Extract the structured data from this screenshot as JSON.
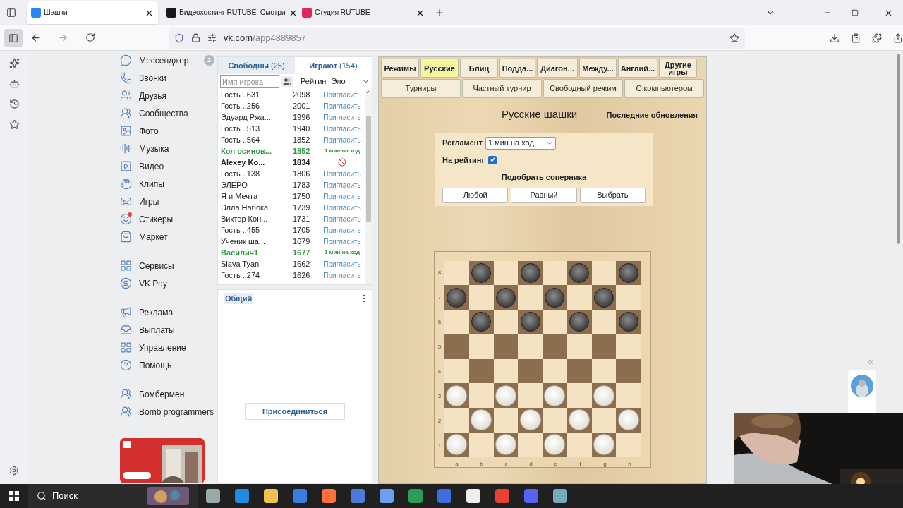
{
  "browser": {
    "tabs": [
      {
        "title": "Шашки",
        "selected": true,
        "color": "#2787f5"
      },
      {
        "title": "Видеохостинг RUTUBE. Смотри",
        "selected": false,
        "color": "#14191f"
      },
      {
        "title": "Студия RUTUBE",
        "selected": false,
        "color": "#e0245e"
      }
    ],
    "url_host": "vk.com",
    "url_path": "/app4889857"
  },
  "nav_groups": [
    [
      {
        "label": "Мессенджер",
        "badge": "2",
        "dot": false
      },
      {
        "label": "Звонки",
        "dot": false
      },
      {
        "label": "Друзья",
        "dot": false
      },
      {
        "label": "Сообщества",
        "dot": false
      },
      {
        "label": "Фото",
        "dot": false
      },
      {
        "label": "Музыка",
        "dot": false
      },
      {
        "label": "Видео",
        "dot": false
      },
      {
        "label": "Клипы",
        "dot": false
      },
      {
        "label": "Игры",
        "dot": false
      },
      {
        "label": "Стикеры",
        "dot": true
      },
      {
        "label": "Маркет",
        "dot": false
      }
    ],
    [
      {
        "label": "Сервисы",
        "dot": false
      },
      {
        "label": "VK Pay",
        "dot": false
      }
    ],
    [
      {
        "label": "Реклама",
        "dot": false
      },
      {
        "label": "Выплаты",
        "dot": false
      },
      {
        "label": "Управление",
        "dot": false
      },
      {
        "label": "Помощь",
        "dot": false
      }
    ],
    [
      {
        "label": "Бомбермен",
        "dot": false
      },
      {
        "label": "Bomb programmers",
        "dot": false
      }
    ]
  ],
  "players": {
    "tabs": [
      {
        "label": "Свободны",
        "count": "(25)",
        "selected": true
      },
      {
        "label": "Играют",
        "count": "(154)",
        "selected": false
      }
    ],
    "search_placeholder": "Имя игрока",
    "sort": "Рейтинг Эло",
    "rows": [
      {
        "name": "Гость ..631",
        "rating": "2098",
        "kind": "invite",
        "action": "Пригласить"
      },
      {
        "name": "Гость ..256",
        "rating": "2001",
        "kind": "invite",
        "action": "Пригласить"
      },
      {
        "name": "Эдуард Ржа...",
        "rating": "1996",
        "kind": "invite",
        "action": "Пригласить"
      },
      {
        "name": "Гость ..513",
        "rating": "1940",
        "kind": "invite",
        "action": "Пригласить"
      },
      {
        "name": "Гость ..564",
        "rating": "1852",
        "kind": "invite",
        "action": "Пригласить"
      },
      {
        "name": "Кол осинов...",
        "rating": "1852",
        "kind": "seeking",
        "action": "1 мин на ход"
      },
      {
        "name": "Alexey Ko...",
        "rating": "1834",
        "kind": "self"
      },
      {
        "name": "Гость ..138",
        "rating": "1806",
        "kind": "invite",
        "action": "Пригласить"
      },
      {
        "name": "ЭЛЕРО",
        "rating": "1783",
        "kind": "invite",
        "action": "Пригласить"
      },
      {
        "name": "Я и Мечта",
        "rating": "1750",
        "kind": "invite",
        "action": "Пригласить"
      },
      {
        "name": "Элла Набока",
        "rating": "1739",
        "kind": "invite",
        "action": "Пригласить"
      },
      {
        "name": "Виктор Кон...",
        "rating": "1731",
        "kind": "invite",
        "action": "Пригласить"
      },
      {
        "name": "Гость ..455",
        "rating": "1705",
        "kind": "invite",
        "action": "Пригласить"
      },
      {
        "name": "Ученик ша...",
        "rating": "1679",
        "kind": "invite",
        "action": "Пригласить"
      },
      {
        "name": "Василич1",
        "rating": "1677",
        "kind": "seeking",
        "action": "1 мин на ход"
      },
      {
        "name": "Slava Tyan",
        "rating": "1662",
        "kind": "invite",
        "action": "Пригласить"
      },
      {
        "name": "Гость ..274",
        "rating": "1626",
        "kind": "invite",
        "action": "Пригласить"
      }
    ]
  },
  "chat": {
    "tab": "Общий",
    "join": "Присоединиться"
  },
  "game": {
    "variants": [
      {
        "label": "Режимы",
        "selected": false
      },
      {
        "label": "Русские",
        "selected": true
      },
      {
        "label": "Блиц",
        "selected": false
      },
      {
        "label": "Подда...",
        "selected": false
      },
      {
        "label": "Диагон...",
        "selected": false
      },
      {
        "label": "Между...",
        "selected": false
      },
      {
        "label": "Англий...",
        "selected": false
      },
      {
        "label": "Другие игры",
        "selected": false
      }
    ],
    "modes": [
      "Турниры",
      "Частный турнир",
      "Свободный режим",
      "С компьютером"
    ],
    "title": "Русские шашки",
    "updates_link": "Последние обновления",
    "settings": {
      "time_label": "Регламент",
      "time_value": "1 мин на ход",
      "rated_label": "На рейтинг",
      "rated": true,
      "opponent_label": "Подобрать соперника",
      "buttons": [
        "Любой",
        "Равный",
        "Выбрать"
      ]
    },
    "board": {
      "ranks": [
        "8",
        "7",
        "6",
        "5",
        "4",
        "3",
        "2",
        "1"
      ],
      "files": [
        "a",
        "b",
        "c",
        "d",
        "e",
        "f",
        "g",
        "h"
      ],
      "rows": [
        {
          "squares": [
            {
              "kind": "empty"
            },
            {
              "kind": "dark_piece"
            },
            {
              "kind": "empty"
            },
            {
              "kind": "dark_piece"
            },
            {
              "kind": "empty"
            },
            {
              "kind": "dark_piece"
            },
            {
              "kind": "empty"
            },
            {
              "kind": "dark_piece"
            }
          ]
        },
        {
          "squares": [
            {
              "kind": "dark_piece"
            },
            {
              "kind": "empty"
            },
            {
              "kind": "dark_piece"
            },
            {
              "kind": "empty"
            },
            {
              "kind": "dark_piece"
            },
            {
              "kind": "empty"
            },
            {
              "kind": "dark_piece"
            },
            {
              "kind": "empty"
            }
          ]
        },
        {
          "squares": [
            {
              "kind": "empty"
            },
            {
              "kind": "dark_piece"
            },
            {
              "kind": "empty"
            },
            {
              "kind": "dark_piece"
            },
            {
              "kind": "empty"
            },
            {
              "kind": "dark_piece"
            },
            {
              "kind": "empty"
            },
            {
              "kind": "dark_piece"
            }
          ]
        },
        {
          "squares": [
            {
              "kind": "empty"
            },
            {
              "kind": "empty"
            },
            {
              "kind": "empty"
            },
            {
              "kind": "empty"
            },
            {
              "kind": "empty"
            },
            {
              "kind": "empty"
            },
            {
              "kind": "empty"
            },
            {
              "kind": "empty"
            }
          ]
        },
        {
          "squares": [
            {
              "kind": "empty"
            },
            {
              "kind": "empty"
            },
            {
              "kind": "empty"
            },
            {
              "kind": "empty"
            },
            {
              "kind": "empty"
            },
            {
              "kind": "empty"
            },
            {
              "kind": "empty"
            },
            {
              "kind": "empty"
            }
          ]
        },
        {
          "squares": [
            {
              "kind": "light_piece"
            },
            {
              "kind": "empty"
            },
            {
              "kind": "light_piece"
            },
            {
              "kind": "empty"
            },
            {
              "kind": "light_piece"
            },
            {
              "kind": "empty"
            },
            {
              "kind": "light_piece"
            },
            {
              "kind": "empty"
            }
          ]
        },
        {
          "squares": [
            {
              "kind": "empty"
            },
            {
              "kind": "light_piece"
            },
            {
              "kind": "empty"
            },
            {
              "kind": "light_piece"
            },
            {
              "kind": "empty"
            },
            {
              "kind": "light_piece"
            },
            {
              "kind": "empty"
            },
            {
              "kind": "light_piece"
            }
          ]
        },
        {
          "squares": [
            {
              "kind": "light_piece"
            },
            {
              "kind": "empty"
            },
            {
              "kind": "light_piece"
            },
            {
              "kind": "empty"
            },
            {
              "kind": "light_piece"
            },
            {
              "kind": "empty"
            },
            {
              "kind": "light_piece"
            },
            {
              "kind": "empty"
            }
          ]
        }
      ]
    }
  },
  "taskbar": {
    "search": "Поиск"
  }
}
